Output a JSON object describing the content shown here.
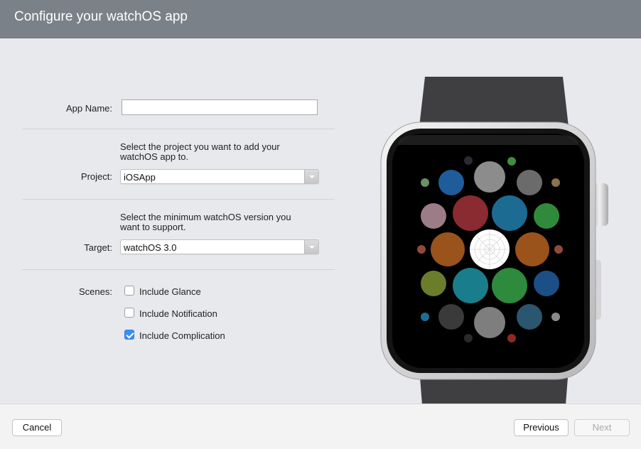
{
  "title": "Configure your watchOS app",
  "app_name": {
    "label": "App Name:",
    "value": ""
  },
  "project": {
    "description": [
      "Select the project you want to add your",
      "watchOS app to."
    ],
    "label": "Project:",
    "value": "iOSApp"
  },
  "target": {
    "description": [
      "Select the minimum watchOS version you",
      "want to support."
    ],
    "label": "Target:",
    "value": "watchOS 3.0"
  },
  "scenes": {
    "label": "Scenes:",
    "options": [
      {
        "label": "Include Glance",
        "checked": false
      },
      {
        "label": "Include Notification",
        "checked": false
      },
      {
        "label": "Include Complication",
        "checked": true
      }
    ]
  },
  "footer": {
    "cancel": "Cancel",
    "previous": "Previous",
    "next": "Next"
  },
  "colors": {
    "titlebar": "#7b8189",
    "checkbox_accent": "#3b8ff6"
  }
}
